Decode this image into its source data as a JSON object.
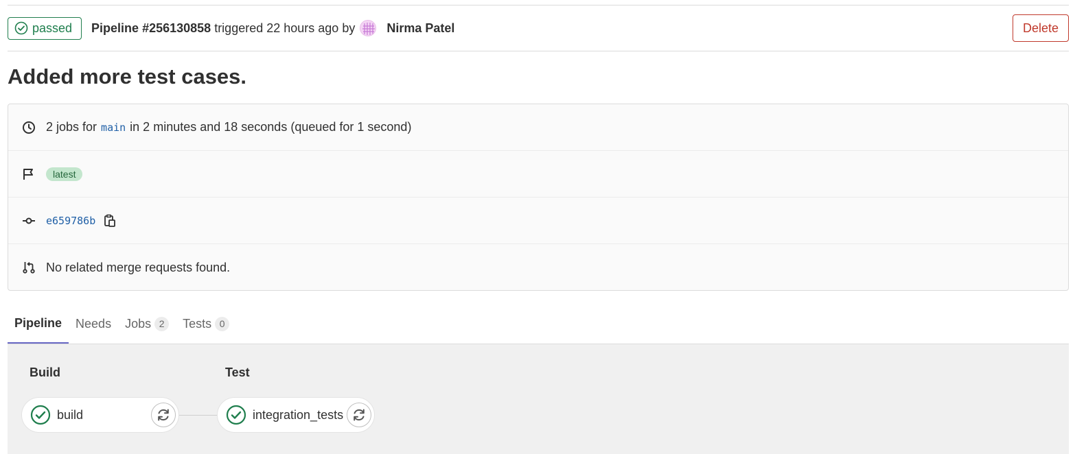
{
  "header": {
    "status_label": "passed",
    "pipeline_id": "Pipeline #256130858",
    "triggered_text": "triggered 22 hours ago by",
    "author_name": "Nirma Patel",
    "delete_label": "Delete"
  },
  "commit_title": "Added more test cases.",
  "info": {
    "jobs_prefix": "2 jobs for",
    "branch": "main",
    "jobs_suffix": "in 2 minutes and 18 seconds (queued for 1 second)",
    "badge": "latest",
    "commit_sha": "e659786b",
    "merge_requests": "No related merge requests found."
  },
  "tabs": [
    {
      "label": "Pipeline",
      "count": null
    },
    {
      "label": "Needs",
      "count": null
    },
    {
      "label": "Jobs",
      "count": "2"
    },
    {
      "label": "Tests",
      "count": "0"
    }
  ],
  "stages": [
    {
      "title": "Build",
      "job": "build"
    },
    {
      "title": "Test",
      "job": "integration_tests"
    }
  ],
  "colors": {
    "success": "#1f7e4d",
    "danger": "#c0392b",
    "link": "#1f5fa6",
    "tab_active": "#6666c4"
  }
}
